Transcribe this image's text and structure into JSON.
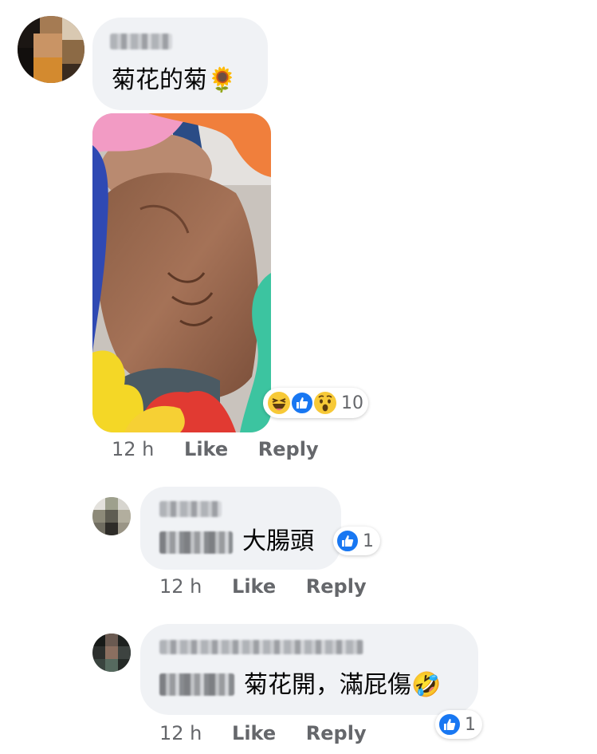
{
  "comments": [
    {
      "text": "菊花的菊",
      "emoji": "🌻",
      "time": "12 h",
      "like_label": "Like",
      "reply_label": "Reply",
      "reactions": {
        "types": [
          "laugh-icon",
          "like-icon",
          "wow-icon"
        ],
        "count": "10"
      }
    },
    {
      "text": "大腸頭",
      "time": "12 h",
      "like_label": "Like",
      "reply_label": "Reply",
      "reactions": {
        "types": [
          "like-icon"
        ],
        "count": "1"
      }
    },
    {
      "text": "菊花開，滿屁傷",
      "emoji": "🤣",
      "time": "12 h",
      "like_label": "Like",
      "reply_label": "Reply",
      "reactions": {
        "types": [
          "like-icon"
        ],
        "count": "1"
      }
    }
  ],
  "colors": {
    "bubble": "#f0f2f5",
    "meta": "#65676b",
    "like_blue": "#1877f2"
  }
}
